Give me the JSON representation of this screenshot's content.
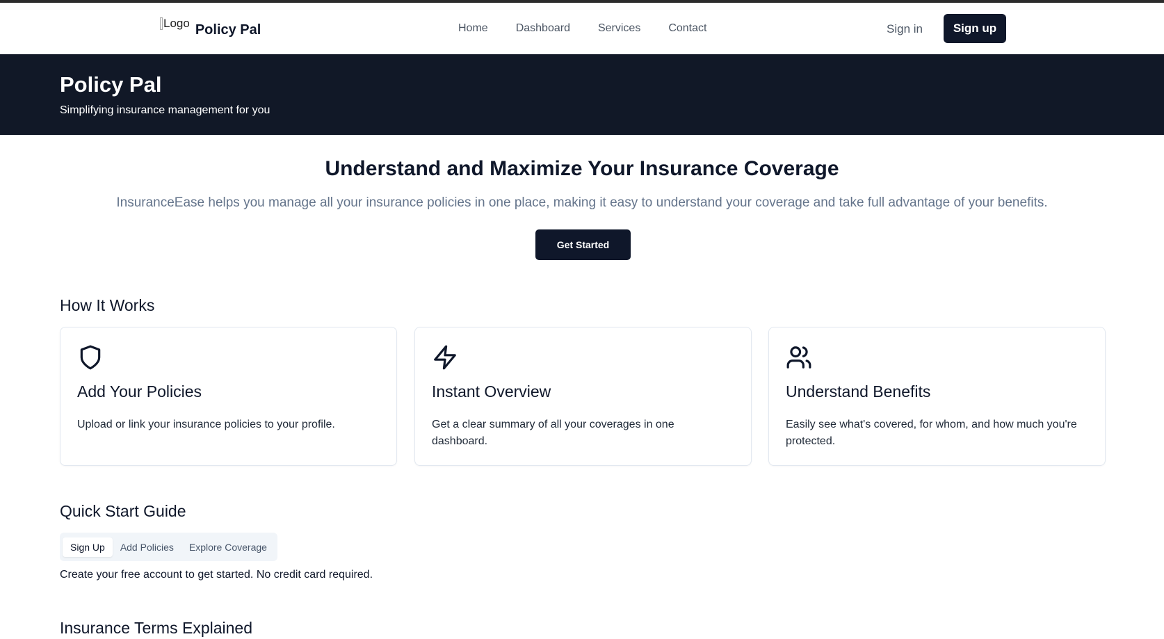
{
  "navbar": {
    "logo_alt": "Logo",
    "brand": "Policy Pal",
    "links": [
      "Home",
      "Dashboard",
      "Services",
      "Contact"
    ],
    "signin": "Sign in",
    "signup": "Sign up"
  },
  "banner": {
    "title": "Policy Pal",
    "subtitle": "Simplifying insurance management for you"
  },
  "hero": {
    "title": "Understand and Maximize Your Insurance Coverage",
    "description": "InsuranceEase helps you manage all your insurance policies in one place, making it easy to understand your coverage and take full advantage of your benefits.",
    "cta": "Get Started"
  },
  "how_it_works": {
    "heading": "How It Works",
    "cards": [
      {
        "icon": "shield-icon",
        "title": "Add Your Policies",
        "description": "Upload or link your insurance policies to your profile."
      },
      {
        "icon": "lightning-icon",
        "title": "Instant Overview",
        "description": "Get a clear summary of all your coverages in one dashboard."
      },
      {
        "icon": "users-icon",
        "title": "Understand Benefits",
        "description": "Easily see what's covered, for whom, and how much you're protected."
      }
    ]
  },
  "quick_start": {
    "heading": "Quick Start Guide",
    "tabs": [
      "Sign Up",
      "Add Policies",
      "Explore Coverage"
    ],
    "active_tab": "Sign Up",
    "content": "Create your free account to get started. No credit card required."
  },
  "terms": {
    "heading": "Insurance Terms Explained"
  },
  "colors": {
    "primary": "#0f172a",
    "banner_bg": "#111827",
    "muted_text": "#64748b",
    "border": "#e2e8f0"
  }
}
